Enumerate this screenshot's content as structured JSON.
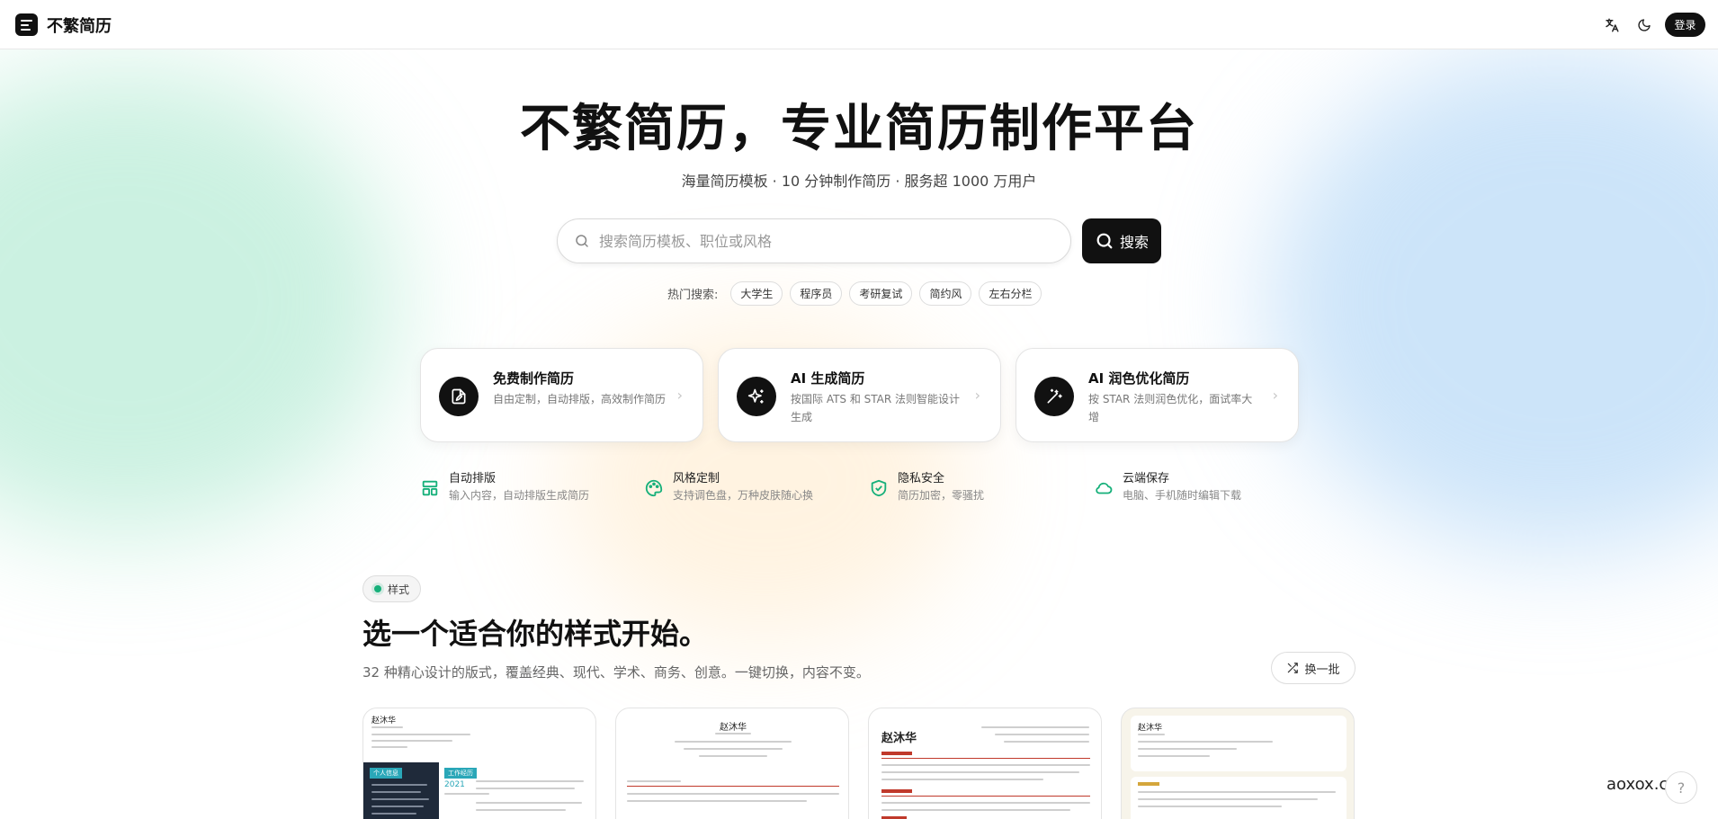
{
  "header": {
    "brand": "不繁简历",
    "translate_icon": "translate-icon",
    "theme_icon": "moon-icon",
    "login_label": "登录"
  },
  "hero": {
    "title": "不繁简历，专业简历制作平台",
    "subtitle": "海量简历模板 · 10 分钟制作简历 · 服务超 1000 万用户"
  },
  "search": {
    "placeholder": "搜索简历模板、职位或风格",
    "button_label": "搜索",
    "hot_label": "热门搜索:",
    "hot_tags": [
      "大学生",
      "程序员",
      "考研复试",
      "简约风",
      "左右分栏"
    ]
  },
  "cards": [
    {
      "title": "免费制作简历",
      "desc": "自由定制，自动排版，高效制作简历",
      "icon": "file-edit-icon"
    },
    {
      "title": "AI 生成简历",
      "desc": "按国际 ATS 和 STAR 法则智能设计生成",
      "icon": "sparkles-icon"
    },
    {
      "title": "AI 润色优化简历",
      "desc": "按 STAR 法则润色优化，面试率大增",
      "icon": "magic-wand-icon"
    }
  ],
  "features": [
    {
      "title": "自动排版",
      "desc": "输入内容，自动排版生成简历",
      "icon": "layout-icon"
    },
    {
      "title": "风格定制",
      "desc": "支持调色盘，万种皮肤随心换",
      "icon": "palette-icon"
    },
    {
      "title": "隐私安全",
      "desc": "简历加密，零骚扰",
      "icon": "shield-check-icon"
    },
    {
      "title": "云端保存",
      "desc": "电脑、手机随时编辑下载",
      "icon": "cloud-icon"
    }
  ],
  "styles_section": {
    "tag": "样式",
    "title": "选一个适合你的样式开始。",
    "desc": "32 种精心设计的版式，覆盖经典、现代、学术、商务、创意。一键切换，内容不变。",
    "refresh_label": "换一批",
    "templates": [
      {
        "name": "赵沐华",
        "year": "2021",
        "badge1": "个人信息",
        "badge2": "工作经历"
      },
      {
        "name": "赵沐华"
      },
      {
        "name": "赵沐华"
      },
      {
        "name": "赵沐华"
      }
    ]
  },
  "footer": {
    "watermark": "aoxox.com",
    "help": "?"
  },
  "colors": {
    "accent": "#111111",
    "feature_icon": "#16b07a",
    "resume_red": "#c0392b",
    "resume_dark": "#1f2a3a",
    "resume_teal": "#2aa7b8"
  }
}
